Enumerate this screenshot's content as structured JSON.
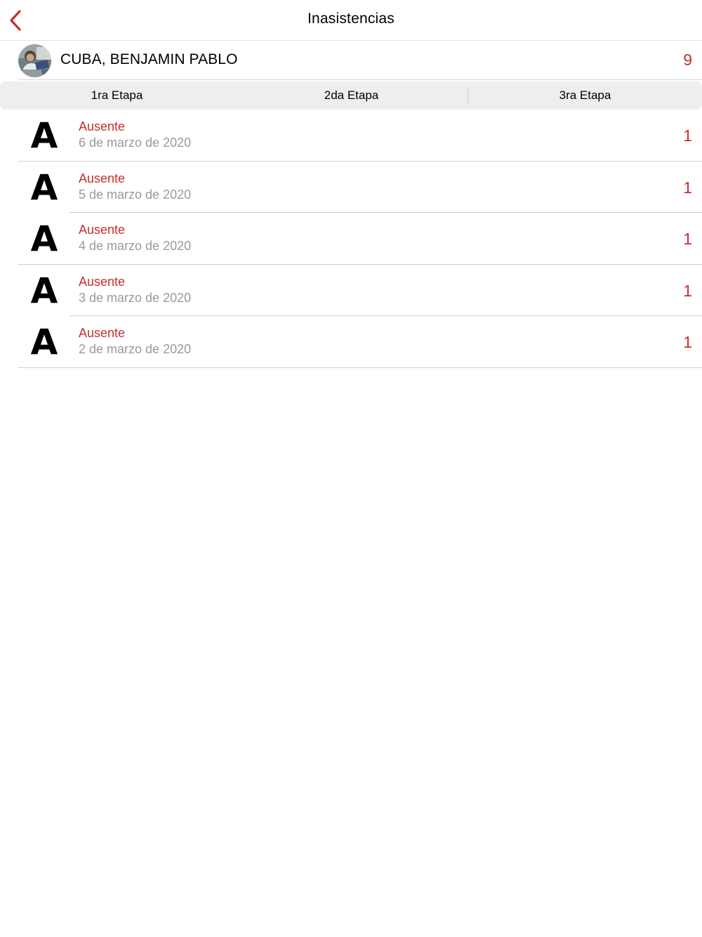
{
  "navbar": {
    "title": "Inasistencias",
    "back_icon": "chevron-left-icon",
    "accent_color": "#c62f2f"
  },
  "student": {
    "name": "CUBA, BENJAMIN PABLO",
    "total": "9",
    "avatar_icon": "student-photo"
  },
  "tabs": [
    {
      "label": "1ra Etapa"
    },
    {
      "label": "2da Etapa"
    },
    {
      "label": "3ra Etapa"
    }
  ],
  "absences": [
    {
      "letter": "A",
      "type": "Ausente",
      "date": "6 de marzo de 2020",
      "value": "1"
    },
    {
      "letter": "A",
      "type": "Ausente",
      "date": "5 de marzo de 2020",
      "value": "1"
    },
    {
      "letter": "A",
      "type": "Ausente",
      "date": "4 de marzo de 2020",
      "value": "1"
    },
    {
      "letter": "A",
      "type": "Ausente",
      "date": "3 de marzo de 2020",
      "value": "1"
    },
    {
      "letter": "A",
      "type": "Ausente",
      "date": "2 de marzo de 2020",
      "value": "1"
    }
  ]
}
